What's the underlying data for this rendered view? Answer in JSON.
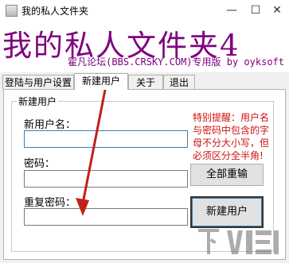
{
  "window": {
    "title": "我的私人文件夹",
    "min_glyph": "—",
    "max_glyph": "☐",
    "close_glyph": "✕"
  },
  "banner": {
    "title": "我的私人文件夹4",
    "subtitle": "霍凡论坛(BBS.CRSKY.COM)专用版 by oyksoft",
    "color": "#800080"
  },
  "tabs": [
    {
      "label": "登陆与用户设置"
    },
    {
      "label": "新建用户"
    },
    {
      "label": "关于"
    },
    {
      "label": "退出"
    }
  ],
  "group": {
    "legend": "新建用户"
  },
  "form": {
    "username_label": "新用户名：",
    "username_value": "",
    "password_label": "密码：",
    "password_value": "",
    "confirm_label": "重复密码：",
    "confirm_value": ""
  },
  "notice": {
    "text": "特别提醒：用户名与密码中包含的字母不分大小写，但必须区分全半角!",
    "color": "#d01010"
  },
  "buttons": {
    "reset_label": "全部重输",
    "create_label": "新建用户"
  },
  "watermark": {
    "text": "下载吧"
  },
  "annotation": {
    "arrow_color": "#c0201a"
  }
}
